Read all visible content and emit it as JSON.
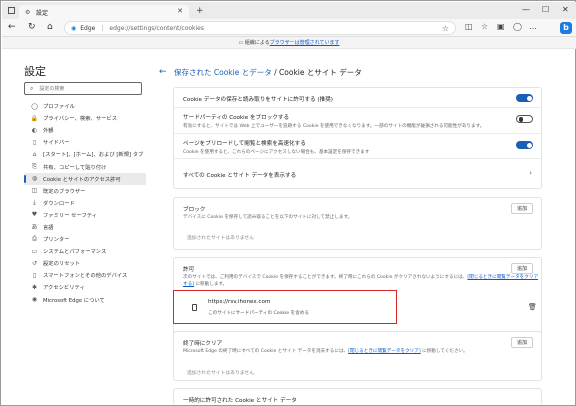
{
  "browser": {
    "tab_title": "設定",
    "address_site": "Edge",
    "address_url": "edge://settings/content/cookies",
    "infobar_prefix": "組織による",
    "infobar_link": "ブラウザーは管理されています",
    "bing_label": "b"
  },
  "sidebar": {
    "title": "設定",
    "search_placeholder": "設定の検索",
    "items": [
      {
        "label": "プロファイル",
        "icon": "profile-icon"
      },
      {
        "label": "プライバシー、検索、サービス",
        "icon": "lock-icon"
      },
      {
        "label": "外観",
        "icon": "appearance-icon"
      },
      {
        "label": "サイドバー",
        "icon": "sidebar-icon"
      },
      {
        "label": "[スタート]、[ホーム]、および [新規] タブ",
        "icon": "home-icon"
      },
      {
        "label": "共有、コピーして貼り付け",
        "icon": "share-icon"
      },
      {
        "label": "Cookie とサイトのアクセス許可",
        "icon": "cookie-icon",
        "active": true
      },
      {
        "label": "既定のブラウザー",
        "icon": "browser-icon"
      },
      {
        "label": "ダウンロード",
        "icon": "download-icon"
      },
      {
        "label": "ファミリー セーフティ",
        "icon": "family-icon"
      },
      {
        "label": "言語",
        "icon": "language-icon"
      },
      {
        "label": "プリンター",
        "icon": "printer-icon"
      },
      {
        "label": "システムとパフォーマンス",
        "icon": "system-icon"
      },
      {
        "label": "設定のリセット",
        "icon": "reset-icon"
      },
      {
        "label": "スマートフォンとその他のデバイス",
        "icon": "phone-icon"
      },
      {
        "label": "アクセシビリティ",
        "icon": "accessibility-icon"
      },
      {
        "label": "Microsoft Edge について",
        "icon": "edge-icon"
      }
    ]
  },
  "main": {
    "breadcrumb_parent": "保存された Cookie とデータ",
    "breadcrumb_sep": " / ",
    "breadcrumb_current": "Cookie とサイト データ",
    "settings": [
      {
        "title": "Cookie データの保存と読み取りをサイトに許可する (推奨)",
        "desc": "",
        "toggle": "on"
      },
      {
        "title": "サードパーティの Cookie をブロックする",
        "desc": "有効にすると、サイトでは Web 上でユーザーを追跡する Cookie を使用できなくなります。一部のサイトの機能が破損される可能性があります。",
        "toggle": "off"
      },
      {
        "title": "ページをプリロードして閲覧と検索を高速化する",
        "desc": "Cookie を使用すると、これらのページにアクセスしない場合も、基本設定を保存できます",
        "toggle": "on"
      },
      {
        "title": "すべての Cookie とサイト データを表示する",
        "desc": "",
        "toggle": "chevron"
      }
    ],
    "block": {
      "title": "ブロック",
      "desc": "デバイスに Cookie を保存して読み取ることを以下のサイトに対して禁止します。",
      "add_label": "追加",
      "empty": "追加されたサイトはありません"
    },
    "allow": {
      "title": "許可",
      "desc_line1": "次のサイトでは、ご利用のデバイスで Cookie を保存することができます。終了時にこれらの Cookie がクリアされないようにするには、",
      "desc_link1": "[閉じるときに閲覧データをクリア",
      "desc_link2": "する]",
      "desc_line2": " に移動します。",
      "add_label": "追加",
      "site_url": "https://rsv.ihonex.com",
      "site_sub": "このサイトにサードパーティの Cookie を含める"
    },
    "clear_on_close": {
      "title": "終了時にクリア",
      "desc_prefix": "Microsoft Edge の終了時にすべての Cookie とサイト データを消去するには、",
      "desc_link": "[閉じるときに閲覧データをクリア]",
      "desc_suffix": " に移動してください。",
      "add_label": "追加",
      "empty": "追加されたサイトはありません"
    },
    "temp_title": "一時的に許可された Cookie とサイト データ"
  },
  "colors": {
    "accent": "#1a5fb4",
    "highlight_border": "#d9262b"
  }
}
